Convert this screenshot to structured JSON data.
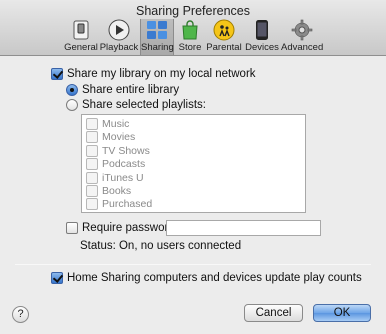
{
  "window": {
    "title": "Sharing Preferences"
  },
  "toolbar": {
    "items": [
      {
        "label": "General",
        "icon": "switch-icon"
      },
      {
        "label": "Playback",
        "icon": "play-icon"
      },
      {
        "label": "Sharing",
        "icon": "sharing-icon",
        "selected": true
      },
      {
        "label": "Store",
        "icon": "store-bag-icon"
      },
      {
        "label": "Parental",
        "icon": "parental-icon"
      },
      {
        "label": "Devices",
        "icon": "iphone-icon"
      },
      {
        "label": "Advanced",
        "icon": "gear-icon"
      }
    ]
  },
  "sharing": {
    "share_library_label": "Share my library on my local network",
    "share_library_checked": true,
    "entire_library_label": "Share entire library",
    "entire_library_selected": true,
    "selected_playlists_label": "Share selected playlists:",
    "playlists": [
      "Music",
      "Movies",
      "TV Shows",
      "Podcasts",
      "iTunes U",
      "Books",
      "Purchased"
    ],
    "require_password_label": "Require password:",
    "require_password_checked": false,
    "password_value": "",
    "status_text": "Status: On, no users connected"
  },
  "home_sharing": {
    "label": "Home Sharing computers and devices update play counts",
    "checked": true
  },
  "footer": {
    "help_label": "?",
    "cancel_label": "Cancel",
    "ok_label": "OK"
  },
  "colors": {
    "accent": "#3675cc",
    "window_bg": "#ececec"
  }
}
